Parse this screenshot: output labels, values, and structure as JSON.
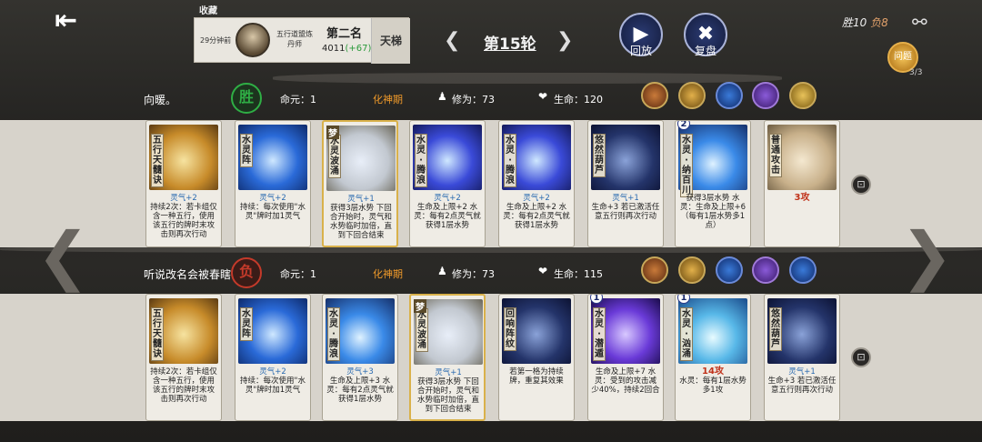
{
  "header": {
    "back_icon": "back-arrow-icon",
    "favorite_label": "收藏",
    "time": "29分钟前",
    "opponent_title": "五行道盟炼丹师",
    "place": "第二名",
    "score": "4011",
    "score_delta": "(+67)",
    "ladder_label": "天梯",
    "round": "第15轮",
    "prev_icon": "chevron-left-icon",
    "next_icon": "chevron-right-icon",
    "replay_label": "回放",
    "review_label": "复盘",
    "wins": "胜10",
    "losses": "负8",
    "quest_label": "问题",
    "quest_count": "3/3"
  },
  "players": [
    {
      "name": "向暖。",
      "result": "胜",
      "life_label": "命元：1",
      "realm": "化神期",
      "cultivation": "修为：73",
      "hp": "生命：120",
      "cards": [
        {
          "label": "五行天髓诀",
          "art": "a-gold",
          "dream": "",
          "level": "",
          "gold": false,
          "lines": [
            {
              "cls": "ql",
              "t": "灵气+2"
            },
            {
              "cls": "",
              "t": "持续2次：若卡组仅含一种五行，使用该五行的牌时末攻击则再次行动"
            }
          ]
        },
        {
          "label": "水灵阵",
          "art": "a-blue",
          "dream": "",
          "level": "",
          "gold": false,
          "lines": [
            {
              "cls": "ql",
              "t": "灵气+2"
            },
            {
              "cls": "",
              "t": "持续：每次使用\"水灵\"牌时加1灵气"
            }
          ]
        },
        {
          "label": "水灵波涌",
          "art": "a-dream",
          "dream": "梦",
          "level": "",
          "gold": true,
          "lines": [
            {
              "cls": "ql",
              "t": "灵气+1"
            },
            {
              "cls": "",
              "t": "获得3层水势 下回合开始时，灵气和水势临时加倍，直到下回合结束"
            }
          ]
        },
        {
          "label": "水灵·腾浪",
          "art": "a-indigo",
          "dream": "",
          "level": "",
          "gold": false,
          "lines": [
            {
              "cls": "ql",
              "t": "灵气+2"
            },
            {
              "cls": "",
              "t": "生命及上限+2 水灵：每有2点灵气就获得1层水势"
            }
          ]
        },
        {
          "label": "水灵·腾浪",
          "art": "a-indigo",
          "dream": "",
          "level": "",
          "gold": false,
          "lines": [
            {
              "cls": "ql",
              "t": "灵气+2"
            },
            {
              "cls": "",
              "t": "生命及上限+2 水灵：每有2点灵气就获得1层水势"
            }
          ]
        },
        {
          "label": "悠然葫芦",
          "art": "a-night",
          "dream": "",
          "level": "",
          "gold": false,
          "lines": [
            {
              "cls": "ql",
              "t": "灵气+1"
            },
            {
              "cls": "",
              "t": "生命+3 若已激活任意五行则再次行动"
            }
          ]
        },
        {
          "label": "水灵·纳百川",
          "art": "a-wave",
          "dream": "",
          "level": "2",
          "gold": false,
          "lines": [
            {
              "cls": "",
              "t": "获得3层水势 水灵：生命及上限+6（每有1层水势多1点）"
            }
          ]
        },
        {
          "label": "普通攻击",
          "art": "a-plain",
          "dream": "",
          "level": "",
          "gold": false,
          "lines": [
            {
              "cls": "big",
              "t": "3攻"
            }
          ]
        }
      ],
      "roster_icons": [
        "warrior-portrait-icon",
        "sun-swirl-icon",
        "water-orb-icon",
        "violet-portrait-icon",
        "gold-portrait-icon"
      ]
    },
    {
      "name": "听说改名会被春瞎",
      "result": "负",
      "life_label": "命元：1",
      "realm": "化神期",
      "cultivation": "修为：73",
      "hp": "生命：115",
      "cards": [
        {
          "label": "五行天髓诀",
          "art": "a-gold",
          "dream": "",
          "level": "",
          "gold": false,
          "lines": [
            {
              "cls": "",
              "t": "持续2次：若卡组仅含一种五行，使用该五行的牌时末攻击则再次行动"
            }
          ]
        },
        {
          "label": "水灵阵",
          "art": "a-blue",
          "dream": "",
          "level": "",
          "gold": false,
          "lines": [
            {
              "cls": "ql",
              "t": "灵气+2"
            },
            {
              "cls": "",
              "t": "持续：每次使用\"水灵\"牌时加1灵气"
            }
          ]
        },
        {
          "label": "水灵·腾浪",
          "art": "a-wave",
          "dream": "",
          "level": "",
          "gold": false,
          "lines": [
            {
              "cls": "ql",
              "t": "灵气+3"
            },
            {
              "cls": "",
              "t": "生命及上限+3 水灵：每有2点灵气就获得1层水势"
            }
          ]
        },
        {
          "label": "水灵波涌",
          "art": "a-dream",
          "dream": "梦",
          "level": "",
          "gold": true,
          "lines": [
            {
              "cls": "ql",
              "t": "灵气+1"
            },
            {
              "cls": "",
              "t": "获得3层水势 下回合开始时，灵气和水势临时加倍，直到下回合结束"
            }
          ]
        },
        {
          "label": "回响阵纹",
          "art": "a-night",
          "dream": "",
          "level": "",
          "gold": false,
          "lines": [
            {
              "cls": "",
              "t": "若第一格为持续牌，重复其效果"
            }
          ]
        },
        {
          "label": "水灵·潜遁",
          "art": "a-violet",
          "dream": "",
          "level": "1",
          "gold": false,
          "lines": [
            {
              "cls": "",
              "t": "生命及上限+7 水灵：受到的攻击减少40%，持续2回合"
            }
          ]
        },
        {
          "label": "水灵·汹涌",
          "art": "a-aqua",
          "dream": "",
          "level": "1",
          "gold": false,
          "lines": [
            {
              "cls": "big",
              "t": "14攻"
            },
            {
              "cls": "",
              "t": "水灵：每有1层水势多1攻"
            }
          ]
        },
        {
          "label": "悠然葫芦",
          "art": "a-night",
          "dream": "",
          "level": "",
          "gold": false,
          "lines": [
            {
              "cls": "ql",
              "t": "灵气+1"
            },
            {
              "cls": "",
              "t": "生命+3 若已激活任意五行则再次行动"
            }
          ]
        }
      ],
      "roster_icons": [
        "warrior-portrait-icon",
        "sun-swirl-icon",
        "water-orb-icon",
        "violet-portrait-icon",
        "water-ring-icon"
      ]
    }
  ],
  "pin_icon": "pin-icon",
  "colors": {
    "win": "#2fae45",
    "lose": "#c43a2a",
    "realm": "#f09a2a",
    "ling_qi": "#2a6ab0"
  }
}
